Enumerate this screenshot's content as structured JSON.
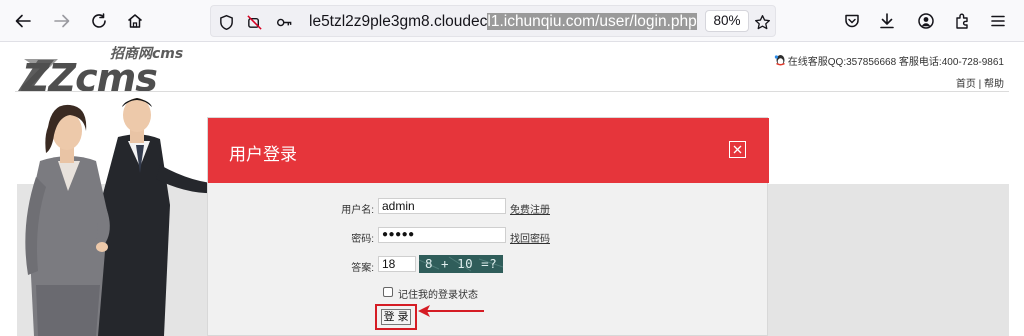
{
  "browser": {
    "url_prefix": "le5tzl2z9ple3gm8.cloudec",
    "url_highlight": "l1.ichunqiu.com/user/login.php",
    "zoom": "80%",
    "icons": [
      "back-arrow-icon",
      "forward-arrow-icon",
      "reload-icon",
      "home-icon",
      "shield-icon",
      "no-camera-icon",
      "key-icon",
      "star-icon",
      "pocket-icon",
      "download-icon",
      "account-icon",
      "extensions-icon",
      "menu-icon"
    ]
  },
  "site": {
    "logo_sub": "招商网cms",
    "logo_main": "ZZcms",
    "contact": "在线客服QQ:357856668 客服电话:400-728-9861",
    "nav_home": "首页",
    "nav_sep": "|",
    "nav_help": "帮助"
  },
  "login": {
    "title": "用户登录",
    "username_label": "用户名:",
    "username_value": "admin",
    "register_link": "免费注册",
    "password_label": "密码:",
    "password_value": "●●●●●",
    "forgot_link": "找回密码",
    "answer_label": "答案:",
    "answer_value": "18",
    "captcha_text": "8 + 10 =?",
    "remember_label": "记住我的登录状态",
    "submit_label": "登 录"
  },
  "colors": {
    "modal_header": "#e6353b",
    "highlight_frame": "#d51c24",
    "captcha_bg": "#2f5d5a"
  }
}
